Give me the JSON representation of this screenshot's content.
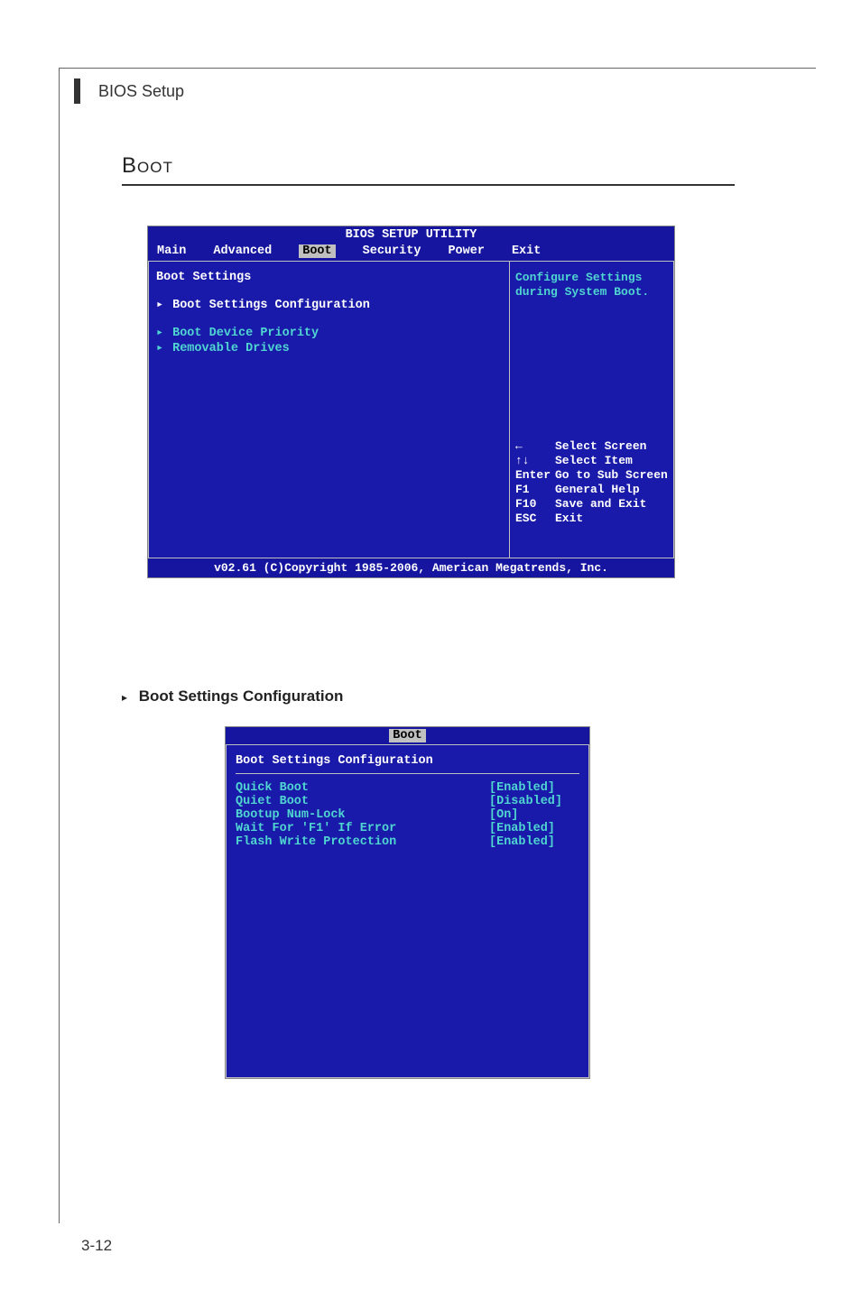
{
  "header": "BIOS Setup",
  "title": "Boot",
  "bios1": {
    "title": "BIOS SETUP UTILITY",
    "tabs": [
      "Main",
      "Advanced",
      "Boot",
      "Security",
      "Power",
      "Exit"
    ],
    "active_tab": "Boot",
    "heading": "Boot Settings",
    "items": [
      "Boot Settings Configuration",
      "Boot Device Priority",
      "Removable Drives"
    ],
    "help_top1": "Configure Settings",
    "help_top2": "during System Boot.",
    "help": [
      {
        "k": "←",
        "v": "Select Screen"
      },
      {
        "k": "↑↓",
        "v": "Select Item"
      },
      {
        "k": "Enter",
        "v": "Go to Sub Screen"
      },
      {
        "k": "F1",
        "v": "General Help"
      },
      {
        "k": "F10",
        "v": "Save and Exit"
      },
      {
        "k": "ESC",
        "v": "Exit"
      }
    ],
    "footer": "v02.61 (C)Copyright 1985-2006, American Megatrends, Inc."
  },
  "section": {
    "arrow": "▸",
    "label": "Boot Settings Configuration"
  },
  "bios2": {
    "title": "Boot",
    "heading": "Boot Settings Configuration",
    "settings": [
      {
        "name": "Quick Boot",
        "value": "[Enabled]"
      },
      {
        "name": "Quiet Boot",
        "value": "[Disabled]"
      },
      {
        "name": "Bootup Num-Lock",
        "value": "[On]"
      },
      {
        "name": "Wait For 'F1' If Error",
        "value": "[Enabled]"
      },
      {
        "name": "Flash Write Protection",
        "value": "[Enabled]"
      }
    ]
  },
  "page_number": "3-12"
}
